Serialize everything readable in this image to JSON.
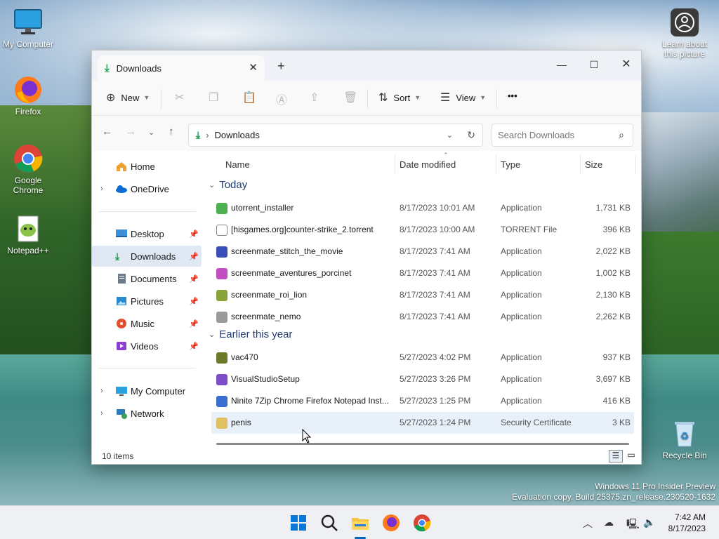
{
  "desktop": {
    "icons": [
      {
        "label": "My Computer",
        "icon": "monitor-icon"
      },
      {
        "label": "Firefox",
        "icon": "firefox-icon"
      },
      {
        "label": "Google Chrome",
        "icon": "chrome-icon"
      },
      {
        "label": "Notepad++",
        "icon": "notepadpp-icon"
      },
      {
        "label": "Learn about this picture",
        "icon": "camera-icon"
      },
      {
        "label": "Recycle Bin",
        "icon": "recycle-bin-icon"
      }
    ],
    "watermark_line1": "Windows 11 Pro Insider Preview",
    "watermark_line2": "Evaluation copy. Build 25375.zn_release.230520-1632"
  },
  "window": {
    "tab_title": "Downloads",
    "toolbar": {
      "new_label": "New",
      "sort_label": "Sort",
      "view_label": "View",
      "more_label": "•••"
    },
    "address": {
      "path_separator": "›",
      "path": "Downloads",
      "search_placeholder": "Search Downloads"
    },
    "sidebar": {
      "home": "Home",
      "onedrive": "OneDrive",
      "desktop": "Desktop",
      "downloads": "Downloads",
      "documents": "Documents",
      "pictures": "Pictures",
      "music": "Music",
      "videos": "Videos",
      "mycomputer": "My Computer",
      "network": "Network"
    },
    "columns": {
      "name": "Name",
      "date": "Date modified",
      "type": "Type",
      "size": "Size"
    },
    "groups": {
      "today": "Today",
      "earlier": "Earlier this year"
    },
    "files": [
      {
        "name": "utorrent_installer",
        "date": "8/17/2023 10:01 AM",
        "type": "Application",
        "size": "1,731 KB",
        "icon_color": "#4caf50"
      },
      {
        "name": "[hisgames.org]counter-strike_2.torrent",
        "date": "8/17/2023 10:00 AM",
        "type": "TORRENT File",
        "size": "396 KB",
        "icon_color": "#ffffff"
      },
      {
        "name": "screenmate_stitch_the_movie",
        "date": "8/17/2023 7:41 AM",
        "type": "Application",
        "size": "2,022 KB",
        "icon_color": "#3a4fb8"
      },
      {
        "name": "screenmate_aventures_porcinet",
        "date": "8/17/2023 7:41 AM",
        "type": "Application",
        "size": "1,002 KB",
        "icon_color": "#c04fc0"
      },
      {
        "name": "screenmate_roi_lion",
        "date": "8/17/2023 7:41 AM",
        "type": "Application",
        "size": "2,130 KB",
        "icon_color": "#8aa23a"
      },
      {
        "name": "screenmate_nemo",
        "date": "8/17/2023 7:41 AM",
        "type": "Application",
        "size": "2,262 KB",
        "icon_color": "#9a9a9a"
      },
      {
        "name": "vac470",
        "date": "5/27/2023 4:02 PM",
        "type": "Application",
        "size": "937 KB",
        "icon_color": "#6a7a2a"
      },
      {
        "name": "VisualStudioSetup",
        "date": "5/27/2023 3:26 PM",
        "type": "Application",
        "size": "3,697 KB",
        "icon_color": "#7b4fc7"
      },
      {
        "name": "Ninite 7Zip Chrome Firefox Notepad Inst...",
        "date": "5/27/2023 1:25 PM",
        "type": "Application",
        "size": "416 KB",
        "icon_color": "#3a6fd0"
      },
      {
        "name": "penis",
        "date": "5/27/2023 1:24 PM",
        "type": "Security Certificate",
        "size": "3 KB",
        "icon_color": "#e0c060"
      }
    ],
    "status": {
      "item_count": "10 items"
    }
  },
  "taskbar": {
    "time": "7:42 AM",
    "date": "8/17/2023"
  },
  "colors": {
    "accent": "#0067c0",
    "download_green": "#1a9b4c",
    "selected_row": "#e8f0fa"
  }
}
